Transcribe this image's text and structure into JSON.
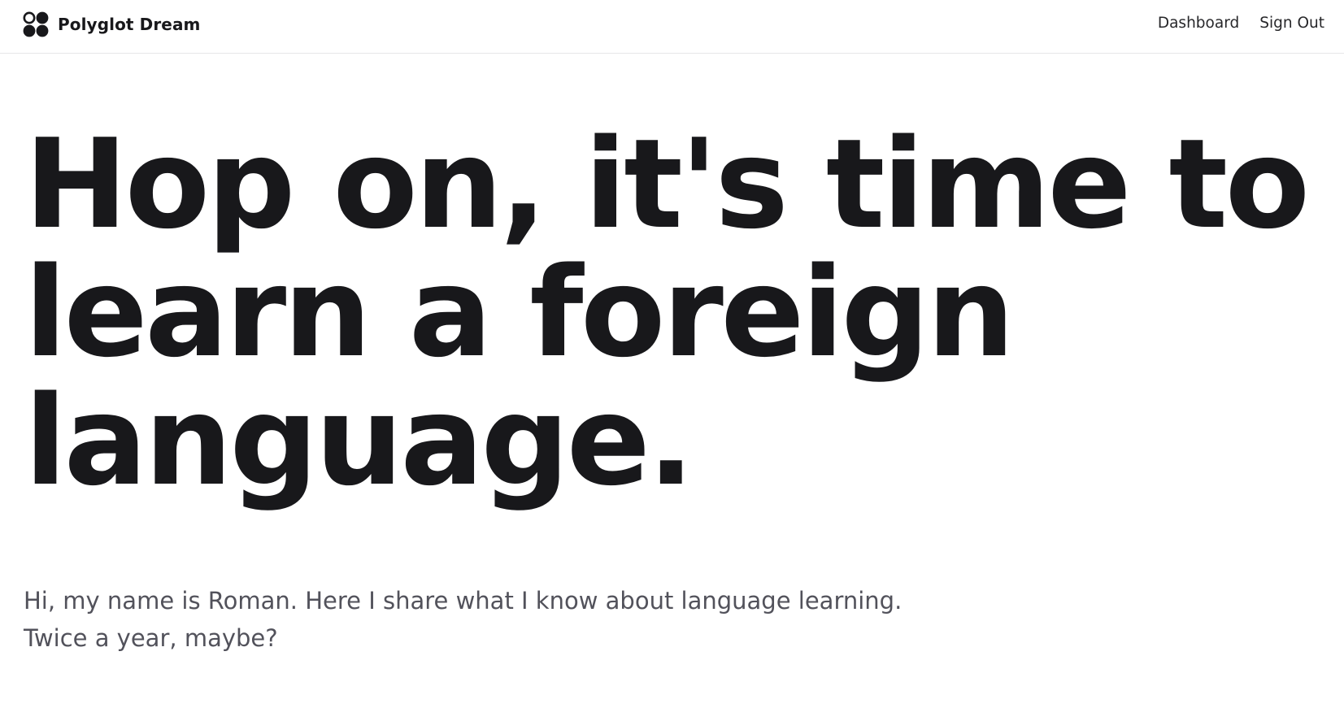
{
  "brand": {
    "icon": "four-dots-logo-icon",
    "name": "Polyglot Dream"
  },
  "nav": {
    "links": [
      {
        "label": "Dashboard"
      },
      {
        "label": "Sign Out"
      }
    ]
  },
  "hero": {
    "title_lines": [
      "Hop on, it's time to",
      "learn a foreign",
      "language."
    ]
  },
  "intro": {
    "lines": [
      "Hi, my name is Roman. Here I share what I know about language learning.",
      "Twice a year, maybe?"
    ]
  },
  "colors": {
    "text_primary": "#18181b",
    "text_secondary": "#52525b",
    "border": "#e6e6e8",
    "background": "#ffffff"
  }
}
